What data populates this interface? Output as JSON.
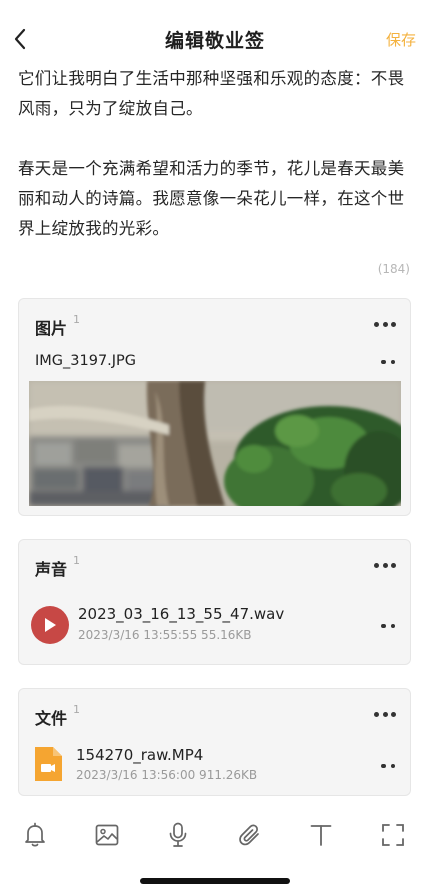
{
  "header": {
    "title": "编辑敬业签",
    "save_label": "保存"
  },
  "note": {
    "paragraphs": [
      "它们让我明白了生活中那种坚强和乐观的态度：不畏风雨，只为了绽放自己。",
      "春天是一个充满希望和活力的季节，花儿是春天最美丽和动人的诗篇。我愿意像一朵花儿一样，在这个世界上绽放我的光彩。"
    ],
    "char_count": "(184)"
  },
  "images_section": {
    "title": "图片",
    "count": "1",
    "file_name": "IMG_3197.JPG"
  },
  "audio_section": {
    "title": "声音",
    "count": "1",
    "file_name": "2023_03_16_13_55_47.wav",
    "meta": "2023/3/16 13:55:55  55.16KB"
  },
  "files_section": {
    "title": "文件",
    "count": "1",
    "file_name": "154270_raw.MP4",
    "meta": "2023/3/16 13:56:00  911.26KB"
  },
  "toolbar": {
    "icons": [
      "bell-icon",
      "image-icon",
      "microphone-icon",
      "paperclip-icon",
      "text-format-icon",
      "fullscreen-icon"
    ]
  },
  "colors": {
    "accent": "#f4b23f",
    "audio_button": "#c74845",
    "file_icon": "#f5a531"
  }
}
